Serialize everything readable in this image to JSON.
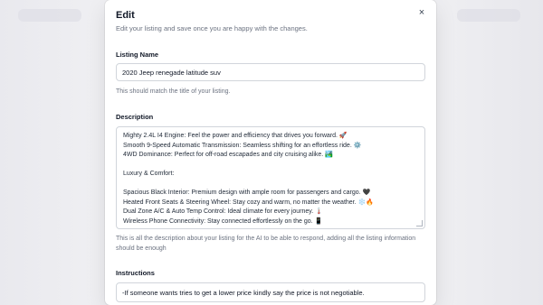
{
  "modal": {
    "title": "Edit",
    "subtitle": "Edit your listing and save once you are happy with the changes.",
    "close_icon": "×"
  },
  "listing_name": {
    "label": "Listing Name",
    "value": "2020 Jeep renegade latitude suv",
    "help": "This should match the title of your listing."
  },
  "description": {
    "label": "Description",
    "lines": [
      "Mighty 2.4L I4 Engine: Feel the power and efficiency that drives you forward. 🚀",
      "Smooth 9-Speed Automatic Transmission: Seamless shifting for an effortless ride. ⚙️",
      "4WD Dominance: Perfect for off-road escapades and city cruising alike. 🏞️",
      "",
      "Luxury & Comfort:",
      "",
      "Spacious Black Interior: Premium design with ample room for passengers and cargo. 🖤",
      "Heated Front Seats & Steering Wheel: Stay cozy and warm, no matter the weather. ❄️🔥",
      "Dual Zone A/C & Auto Temp Control: Ideal climate for every journey. 🌡️",
      "Wireless Phone Connectivity: Stay connected effortlessly on the go. 📱"
    ],
    "help": "This is all the description about your listing for the AI to be able to respond, adding all the listing information should be enough"
  },
  "instructions": {
    "label": "Instructions",
    "value": "-If someone wants tries to  get a lower price kindly say the price is not negotiable."
  }
}
